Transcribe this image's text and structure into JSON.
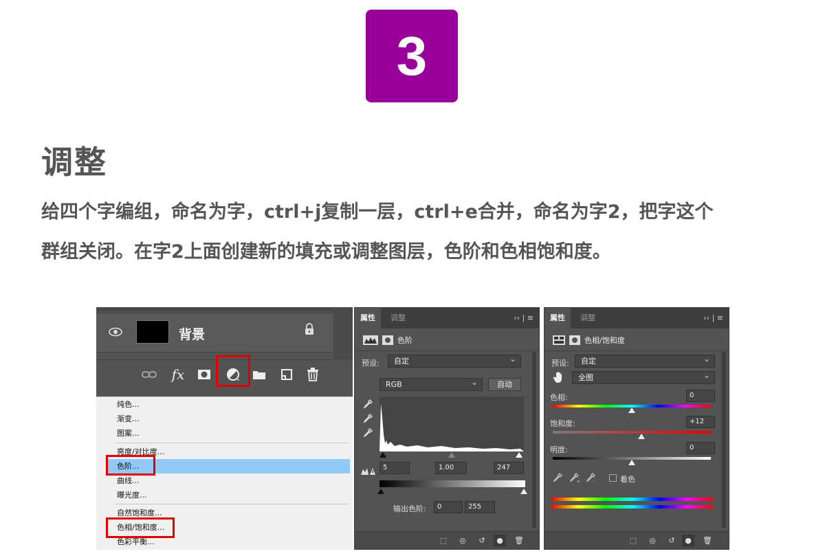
{
  "step": {
    "number": "3",
    "color": "#990099"
  },
  "section": {
    "title": "调整"
  },
  "description": {
    "line1": "给四个字编组，命名为字，ctrl+j复制一层，ctrl+e合并，命名为字2，把字这个",
    "line2": "群组关闭。在字2上面创建新的填充或调整图层，色阶和色相饱和度。"
  },
  "layers_panel": {
    "layer": {
      "name": "背景"
    },
    "tools": [
      "link-icon",
      "fx-icon",
      "mask-icon",
      "adjustment-icon",
      "folder-icon",
      "new-layer-icon",
      "trash-icon"
    ],
    "fx_label": "fx",
    "menu": {
      "items": [
        "纯色...",
        "渐变...",
        "图案...",
        "亮度/对比度...",
        "色阶...",
        "曲线...",
        "曝光度...",
        "自然饱和度...",
        "色相/饱和度...",
        "色彩平衡..."
      ],
      "highlighted": "色阶..."
    }
  },
  "levels_panel": {
    "tabs": [
      "属性",
      "调整"
    ],
    "menu_glyph": "›› | ≡",
    "title": "色阶",
    "preset_label": "预设:",
    "preset_value": "自定",
    "channel_value": "RGB",
    "auto_label": "自动",
    "input": {
      "black": "5",
      "gamma": "1.00",
      "white": "247"
    },
    "output_label": "输出色阶:",
    "output": {
      "black": "0",
      "white": "255"
    }
  },
  "hue_panel": {
    "tabs": [
      "属性",
      "调整"
    ],
    "menu_glyph": "›› | ≡",
    "title": "色相/饱和度",
    "preset_label": "预设:",
    "preset_value": "自定",
    "range_value": "全图",
    "hue_label": "色相:",
    "hue_value": "0",
    "saturation_label": "饱和度:",
    "saturation_value": "+12",
    "lightness_label": "明度:",
    "lightness_value": "0",
    "colorize_label": "着色"
  }
}
